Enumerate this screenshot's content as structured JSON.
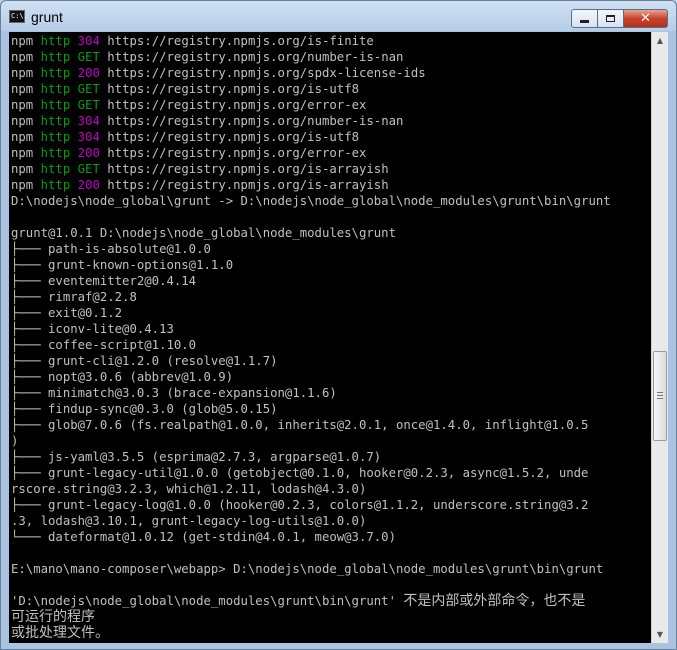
{
  "window": {
    "title": "grunt",
    "icon_label": "C:\\.",
    "minimize_icon": "minimize-icon",
    "maximize_icon": "maximize-icon",
    "close_symbol": "✕"
  },
  "console": {
    "lines": [
      [
        {
          "t": "npm "
        },
        {
          "t": "http ",
          "c": "g"
        },
        {
          "t": "304 ",
          "c": "m"
        },
        {
          "t": "https://registry.npmjs.org/is-finite"
        }
      ],
      [
        {
          "t": "npm "
        },
        {
          "t": "http ",
          "c": "g"
        },
        {
          "t": "GET ",
          "c": "g"
        },
        {
          "t": "https://registry.npmjs.org/number-is-nan"
        }
      ],
      [
        {
          "t": "npm "
        },
        {
          "t": "http ",
          "c": "g"
        },
        {
          "t": "200 ",
          "c": "m"
        },
        {
          "t": "https://registry.npmjs.org/spdx-license-ids"
        }
      ],
      [
        {
          "t": "npm "
        },
        {
          "t": "http ",
          "c": "g"
        },
        {
          "t": "GET ",
          "c": "g"
        },
        {
          "t": "https://registry.npmjs.org/is-utf8"
        }
      ],
      [
        {
          "t": "npm "
        },
        {
          "t": "http ",
          "c": "g"
        },
        {
          "t": "GET ",
          "c": "g"
        },
        {
          "t": "https://registry.npmjs.org/error-ex"
        }
      ],
      [
        {
          "t": "npm "
        },
        {
          "t": "http ",
          "c": "g"
        },
        {
          "t": "304 ",
          "c": "m"
        },
        {
          "t": "https://registry.npmjs.org/number-is-nan"
        }
      ],
      [
        {
          "t": "npm "
        },
        {
          "t": "http ",
          "c": "g"
        },
        {
          "t": "304 ",
          "c": "m"
        },
        {
          "t": "https://registry.npmjs.org/is-utf8"
        }
      ],
      [
        {
          "t": "npm "
        },
        {
          "t": "http ",
          "c": "g"
        },
        {
          "t": "200 ",
          "c": "m"
        },
        {
          "t": "https://registry.npmjs.org/error-ex"
        }
      ],
      [
        {
          "t": "npm "
        },
        {
          "t": "http ",
          "c": "g"
        },
        {
          "t": "GET ",
          "c": "g"
        },
        {
          "t": "https://registry.npmjs.org/is-arrayish"
        }
      ],
      [
        {
          "t": "npm "
        },
        {
          "t": "http ",
          "c": "g"
        },
        {
          "t": "200 ",
          "c": "m"
        },
        {
          "t": "https://registry.npmjs.org/is-arrayish"
        }
      ],
      [
        {
          "t": "D:\\nodejs\\node_global\\grunt -> D:\\nodejs\\node_global\\node_modules\\grunt\\bin\\grunt"
        }
      ],
      [
        {
          "t": ""
        }
      ],
      [
        {
          "t": "grunt@1.0.1 D:\\nodejs\\node_global\\node_modules\\grunt"
        }
      ],
      [
        {
          "t": "├─── path-is-absolute@1.0.0"
        }
      ],
      [
        {
          "t": "├─── grunt-known-options@1.1.0"
        }
      ],
      [
        {
          "t": "├─── eventemitter2@0.4.14"
        }
      ],
      [
        {
          "t": "├─── rimraf@2.2.8"
        }
      ],
      [
        {
          "t": "├─── exit@0.1.2"
        }
      ],
      [
        {
          "t": "├─── iconv-lite@0.4.13"
        }
      ],
      [
        {
          "t": "├─── coffee-script@1.10.0"
        }
      ],
      [
        {
          "t": "├─── grunt-cli@1.2.0 (resolve@1.1.7)"
        }
      ],
      [
        {
          "t": "├─── nopt@3.0.6 (abbrev@1.0.9)"
        }
      ],
      [
        {
          "t": "├─── minimatch@3.0.3 (brace-expansion@1.1.6)"
        }
      ],
      [
        {
          "t": "├─── findup-sync@0.3.0 (glob@5.0.15)"
        }
      ],
      [
        {
          "t": "├─── glob@7.0.6 (fs.realpath@1.0.0, inherits@2.0.1, once@1.4.0, inflight@1.0.5"
        }
      ],
      [
        {
          "t": ")"
        }
      ],
      [
        {
          "t": "├─── js-yaml@3.5.5 (esprima@2.7.3, argparse@1.0.7)"
        }
      ],
      [
        {
          "t": "├─── grunt-legacy-util@1.0.0 (getobject@0.1.0, hooker@0.2.3, async@1.5.2, unde"
        }
      ],
      [
        {
          "t": "rscore.string@3.2.3, which@1.2.11, lodash@4.3.0)"
        }
      ],
      [
        {
          "t": "├─── grunt-legacy-log@1.0.0 (hooker@0.2.3, colors@1.1.2, underscore.string@3.2"
        }
      ],
      [
        {
          "t": ".3, lodash@3.10.1, grunt-legacy-log-utils@1.0.0)"
        }
      ],
      [
        {
          "t": "└─── dateformat@1.0.12 (get-stdin@4.0.1, meow@3.7.0)"
        }
      ],
      [
        {
          "t": ""
        }
      ],
      [
        {
          "t": "E:\\mano\\mano-composer\\webapp> D:\\nodejs\\node_global\\node_modules\\grunt\\bin\\grunt"
        }
      ],
      [
        {
          "t": ""
        }
      ],
      [
        {
          "t": "'D:\\nodejs\\node_global\\node_modules\\grunt\\bin\\grunt' "
        },
        {
          "t": "不是内部或外部命令，也不是",
          "c": "cjk"
        }
      ],
      [
        {
          "t": "可运行的程序",
          "c": "cjk"
        }
      ],
      [
        {
          "t": "或批处理文件。",
          "c": "cjk"
        }
      ]
    ]
  },
  "scrollbar": {
    "up_arrow": "▲",
    "down_arrow": "▼",
    "position": 0.62
  }
}
